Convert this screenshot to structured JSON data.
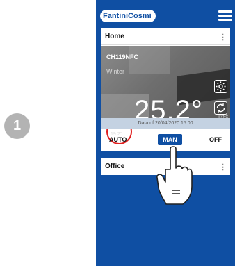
{
  "step_badge": "1",
  "app": {
    "logo_text": "FantiniCosmi"
  },
  "cards": {
    "home": {
      "title": "Home",
      "device_name": "CH119NFC",
      "season": "Winter",
      "temperature": "25.2°",
      "mode_label": "MAN",
      "setpoint": "19.2°",
      "sync_label": "SYNC",
      "status_text": "Data of 20/04/2020 15:00",
      "modes": {
        "auto": "AUTO",
        "man": "MAN",
        "off": "OFF"
      },
      "selected_mode": "MAN"
    },
    "office": {
      "title": "Office"
    }
  },
  "colors": {
    "brand_blue": "#0f4fa3",
    "highlight_red": "#e02020",
    "status_bar": "#c4d2e2"
  },
  "icons": [
    "gear-icon",
    "sync-icon",
    "menu-icon",
    "more-vert-icon",
    "hand-pointer-icon"
  ]
}
